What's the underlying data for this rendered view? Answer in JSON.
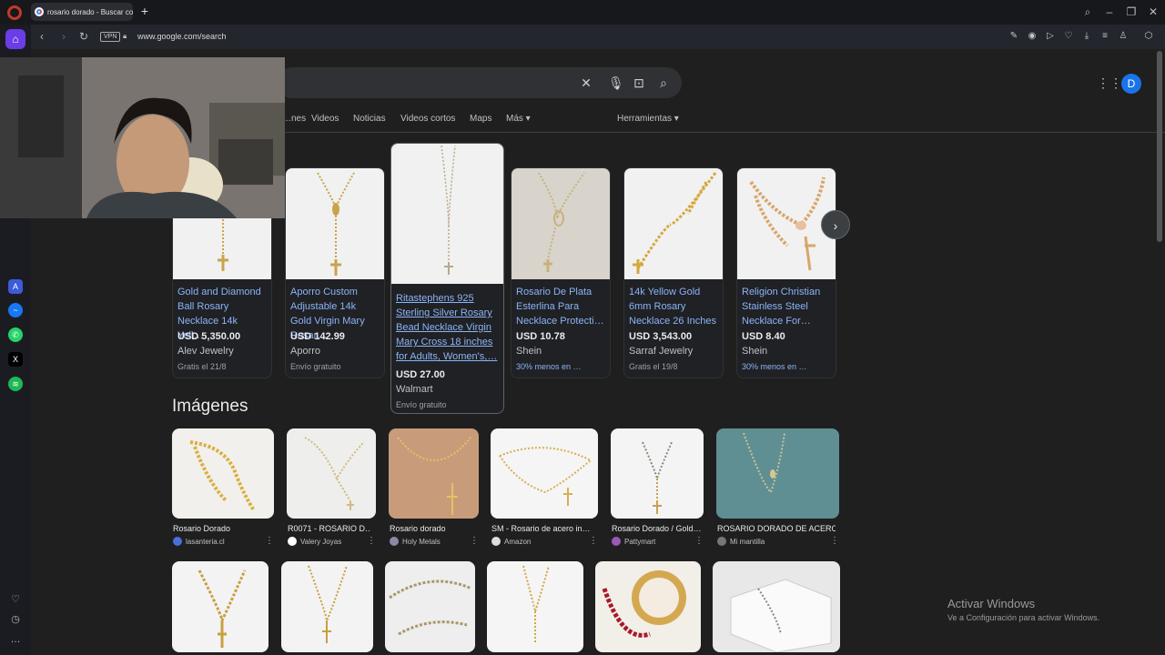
{
  "browser": {
    "tab_title": "rosario dorado - Buscar con Google",
    "url": "www.google.com/search",
    "vpn_label": "VPN"
  },
  "search": {
    "tabs": [
      "…nes",
      "Videos",
      "Noticias",
      "Videos cortos",
      "Maps",
      "Más ▾"
    ],
    "tools_label": "Herramientas ▾",
    "avatar_letter": "D"
  },
  "products": [
    {
      "title": "Gold and Diamond Ball Rosary Necklace 14k Yell…",
      "price": "USD 5,350.00",
      "seller": "Alev Jewelry",
      "shipping": "Gratis el 21/8"
    },
    {
      "title": "Aporro Custom Adjustable 14k Gold Virgin Mary Rosar…",
      "price": "USD 142.99",
      "seller": "Aporro",
      "shipping": "Envío gratuito"
    },
    {
      "title": "Ritastephens 925 Sterling Silver Rosary Bead Necklace Virgin Mary Cross 18 inches for Adults, Women's,…",
      "price": "USD 27.00",
      "seller": "Walmart",
      "shipping": "Envío gratuito"
    },
    {
      "title": "Rosario De Plata Esterlina Para Necklace Protecti…",
      "price": "USD 10.78",
      "seller": "Shein",
      "shipping": "30% menos en …"
    },
    {
      "title": "14k Yellow Gold 6mm Rosary Necklace 26 Inches",
      "price": "USD 3,543.00",
      "seller": "Sarraf Jewelry",
      "shipping": "Gratis el 19/8"
    },
    {
      "title": "Religion Christian Stainless Steel Necklace For…",
      "price": "USD 8.40",
      "seller": "Shein",
      "shipping": "30% menos en …"
    }
  ],
  "images_heading": "Imágenes",
  "images": [
    {
      "caption": "Rosario Dorado",
      "source": "lasanteria.cl"
    },
    {
      "caption": "R0071 - ROSARIO D…",
      "source": "Valery Joyas"
    },
    {
      "caption": "Rosario dorado",
      "source": "Holy Metals"
    },
    {
      "caption": "SM - Rosario de acero in…",
      "source": "Amazon"
    },
    {
      "caption": "Rosario Dorado / Gold…",
      "source": "Pattymart"
    },
    {
      "caption": "ROSARIO DORADO DE ACERO",
      "source": "Mi mantilla"
    }
  ],
  "windows_notice": {
    "line1": "Activar Windows",
    "line2": "Ve a Configuración para activar Windows."
  },
  "colors": {
    "link": "#8ab4f8",
    "page_bg": "#1f1f1f",
    "accent": "#6a3de8"
  }
}
